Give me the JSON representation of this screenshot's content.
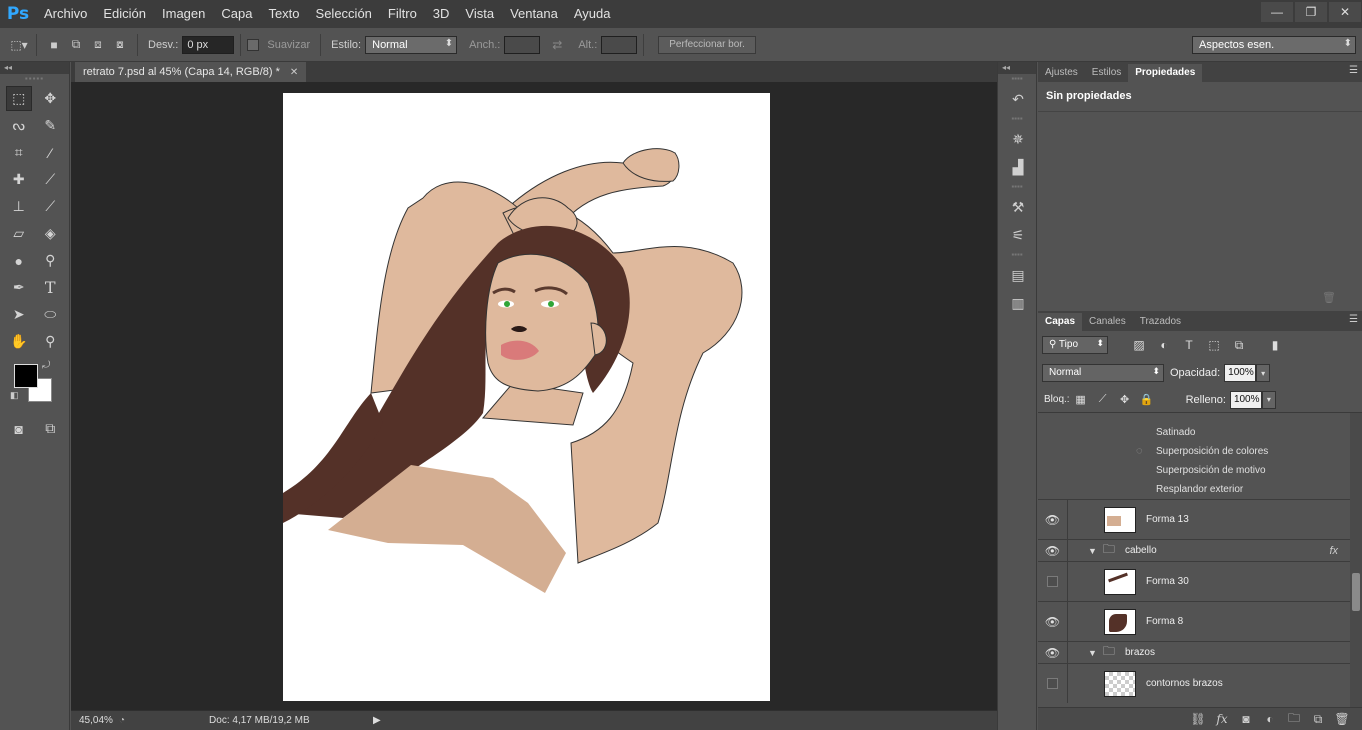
{
  "app": {
    "logo": "Ps",
    "menu": [
      "Archivo",
      "Edición",
      "Imagen",
      "Capa",
      "Texto",
      "Selección",
      "Filtro",
      "3D",
      "Vista",
      "Ventana",
      "Ayuda"
    ]
  },
  "options": {
    "feather_label": "Desv.:",
    "feather_value": "0 px",
    "smooth_label": "Suavizar",
    "style_label": "Estilo:",
    "style_value": "Normal",
    "width_label": "Anch.:",
    "height_label": "Alt.:",
    "refine_label": "Perfeccionar bor.",
    "workspace": "Aspectos esen."
  },
  "document": {
    "tab_title": "retrato 7.psd al 45% (Capa 14, RGB/8) *",
    "zoom": "45,04%",
    "doc_info": "Doc: 4,17 MB/19,2 MB"
  },
  "props_panel": {
    "tabs": [
      "Ajustes",
      "Estilos",
      "Propiedades"
    ],
    "title": "Sin propiedades"
  },
  "layers_panel": {
    "tabs": [
      "Capas",
      "Canales",
      "Trazados"
    ],
    "filter": "Tipo",
    "blend_mode": "Normal",
    "opacity_label": "Opacidad:",
    "opacity_value": "100%",
    "lock_label": "Bloq.:",
    "fill_label": "Relleno:",
    "fill_value": "100%",
    "effects": [
      "Satinado",
      "Superposición de colores",
      "Superposición de motivo",
      "Resplandor exterior"
    ],
    "layers": {
      "forma13": "Forma 13",
      "cabello": "cabello",
      "forma30": "Forma 30",
      "forma8": "Forma 8",
      "brazos": "brazos",
      "contornos": "contornos brazos"
    }
  },
  "colors": {
    "skin": "#dfb99d",
    "hair": "#543128",
    "lips": "#d97a7a",
    "accent_blue": "#31a8ff"
  }
}
